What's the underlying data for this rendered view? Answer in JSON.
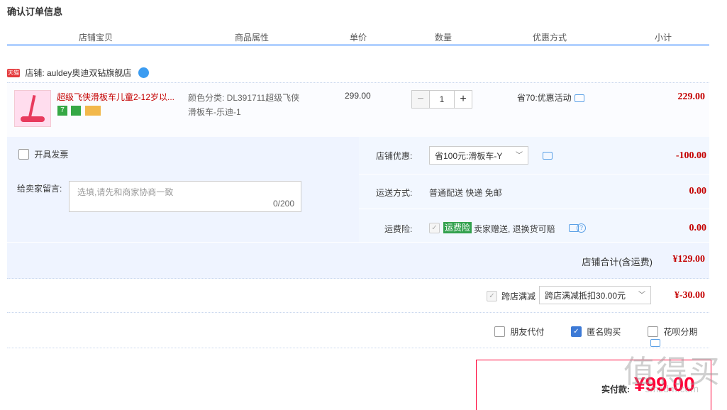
{
  "page_title": "确认订单信息",
  "columns": [
    "店铺宝贝",
    "商品属性",
    "单价",
    "数量",
    "优惠方式",
    "小计"
  ],
  "shop": {
    "badge": "天猫",
    "label": "店铺: auldey奥迪双钻旗舰店"
  },
  "item": {
    "name": "超级飞侠滑板车儿童2-12岁以...",
    "attr_line1": "颜色分类: DL391711超级飞侠",
    "attr_line2": "滑板车-乐迪-1",
    "price": "299.00",
    "quantity": "1",
    "minus": "−",
    "plus": "+",
    "promo": "省70:优惠活动",
    "subtotal": "229.00",
    "badge_seven": "7"
  },
  "options": {
    "invoice_label": "开具发票",
    "message_label": "给卖家留言:",
    "message_placeholder": "选填,请先和商家协商一致",
    "message_count": "0/200",
    "shop_discount_label": "店铺优惠:",
    "shop_discount_value": "省100元:滑板车-Y",
    "shop_discount_amount": "-100.00",
    "shipping_label": "运送方式:",
    "shipping_value": "普通配送 快递 免邮",
    "shipping_amount": "0.00",
    "insurance_label": "运费险:",
    "insurance_tag": "运费险",
    "insurance_text": "卖家赠送, 退换货可赔",
    "insurance_amount": "0.00",
    "check_mark": "✓",
    "question_mark": "?"
  },
  "shop_total": {
    "label": "店铺合计(含运费)",
    "amount": "¥129.00"
  },
  "cross_shop": {
    "label": "跨店满减",
    "select": "跨店满减抵扣30.00元",
    "amount": "¥-30.00"
  },
  "checkboxes": {
    "friend_pay": "朋友代付",
    "anonymous": "匿名购买",
    "huabei": "花呗分期"
  },
  "payment": {
    "label": "实付款:",
    "amount": "¥99.00"
  },
  "watermark": {
    "main": "值得买",
    "sub": "smzdm.com"
  },
  "colors": {
    "accent_red": "#c40000",
    "header_line": "#b2d1ff",
    "panel_bg": "#eff4ff"
  }
}
